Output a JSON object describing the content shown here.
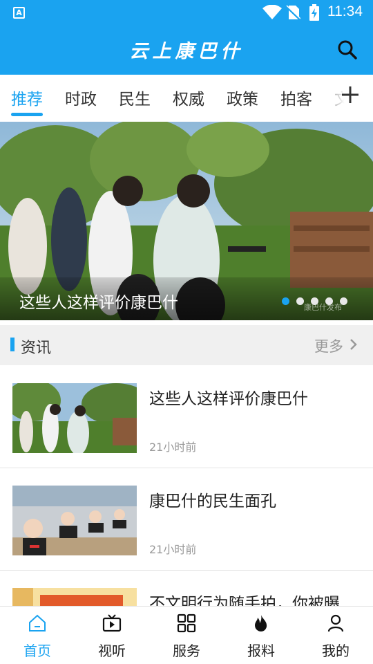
{
  "status_bar": {
    "time": "11:34",
    "icons": [
      "accessibility-icon",
      "wifi-icon",
      "no-sim-icon",
      "battery-charging-icon"
    ]
  },
  "header": {
    "title": "云上康巴什",
    "search_icon": "search-icon"
  },
  "tabs": [
    {
      "label": "推荐",
      "active": true
    },
    {
      "label": "时政",
      "active": false
    },
    {
      "label": "民生",
      "active": false
    },
    {
      "label": "权威",
      "active": false
    },
    {
      "label": "政策",
      "active": false
    },
    {
      "label": "拍客",
      "active": false
    },
    {
      "label": "文",
      "active": false
    }
  ],
  "add_tab_icon": "plus-icon",
  "banner": {
    "caption": "这些人这样评价康巴什",
    "watermark": "康巴什发布",
    "slide_count": 5,
    "active_slide": 1
  },
  "section": {
    "title": "资讯",
    "more_label": "更多"
  },
  "news": [
    {
      "title": "这些人这样评价康巴什",
      "time": "21小时前"
    },
    {
      "title": "康巴什的民生面孔",
      "time": "21小时前"
    },
    {
      "title": "不文明行为随手拍，你被曝",
      "time": ""
    }
  ],
  "bottom_nav": [
    {
      "label": "首页",
      "icon": "home-icon",
      "active": true
    },
    {
      "label": "视听",
      "icon": "tv-icon",
      "active": false
    },
    {
      "label": "服务",
      "icon": "grid-icon",
      "active": false
    },
    {
      "label": "报料",
      "icon": "flame-icon",
      "active": false
    },
    {
      "label": "我的",
      "icon": "user-icon",
      "active": false
    }
  ],
  "colors": {
    "accent": "#1aa3f0",
    "section_bg": "#f0f0f0",
    "muted_text": "#999999"
  }
}
